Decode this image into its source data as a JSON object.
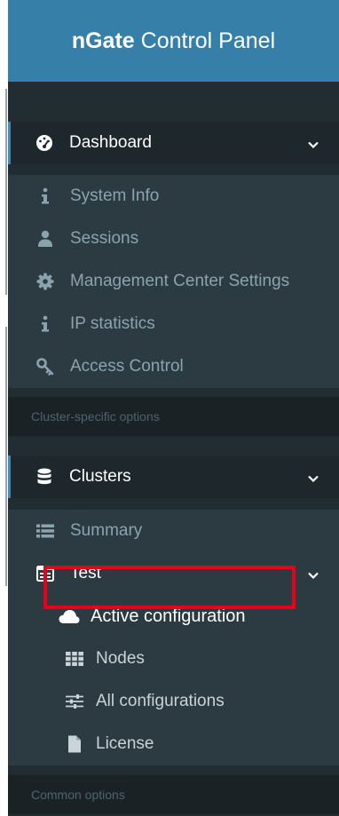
{
  "header": {
    "brand_bold": "nGate",
    "brand_rest": " Control Panel"
  },
  "dashboard": {
    "label": "Dashboard",
    "items": [
      {
        "label": "System Info",
        "icon": "info-icon"
      },
      {
        "label": "Sessions",
        "icon": "user-icon"
      },
      {
        "label": "Management Center Settings",
        "icon": "gear-icon"
      },
      {
        "label": "IP statistics",
        "icon": "info-icon"
      },
      {
        "label": "Access Control",
        "icon": "key-icon"
      }
    ]
  },
  "section_cluster": "Cluster-specific options",
  "clusters": {
    "label": "Clusters",
    "summary_label": "Summary",
    "test": {
      "label": "Test",
      "items": [
        {
          "label": "Active configuration",
          "icon": "cloud-icon"
        },
        {
          "label": "Nodes",
          "icon": "grid-icon"
        },
        {
          "label": "All configurations",
          "icon": "sliders-icon"
        },
        {
          "label": "License",
          "icon": "file-icon"
        }
      ]
    }
  },
  "section_common": "Common options",
  "colors": {
    "header": "#367fa9",
    "sidebar": "#222d32",
    "submenu": "#2c3b41",
    "active_border": "#3c8dbc",
    "highlight": "#e8001c"
  }
}
